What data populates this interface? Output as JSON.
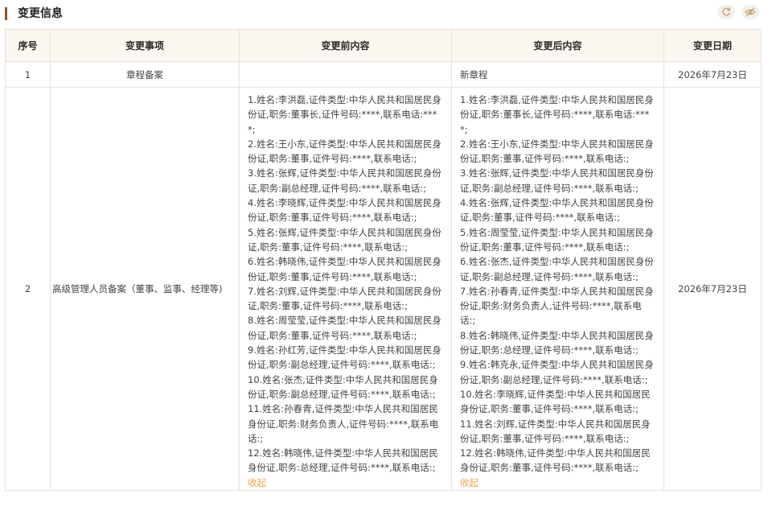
{
  "section": {
    "title": "变更信息"
  },
  "icons": {
    "refresh": "refresh-icon",
    "hide": "eye-off-icon"
  },
  "colors": {
    "accent_bar": "#8b572a",
    "header_bg": "#fcf6f1",
    "border": "#ebe2d8",
    "link": "#f2a652"
  },
  "table": {
    "headers": {
      "index": "序号",
      "item": "变更事项",
      "before": "变更前内容",
      "after": "变更后内容",
      "date": "变更日期"
    },
    "rows": [
      {
        "index": "1",
        "item": "章程备案",
        "before": "",
        "after": "新章程",
        "date": "2026年7月23日"
      },
      {
        "index": "2",
        "item": "高级管理人员备案（董事、监事、经理等)",
        "date": "2026年7月23日",
        "before_entries": [
          "1.姓名:李洪磊,证件类型:中华人民共和国居民身份证,职务:董事长,证件号码:****,联系电话:****;",
          "2.姓名:王小东,证件类型:中华人民共和国居民身份证,职务:董事,证件号码:****,联系电话:;",
          "3.姓名:张辉,证件类型:中华人民共和国居民身份证,职务:副总经理,证件号码:****,联系电话:;",
          "4.姓名:李晓辉,证件类型:中华人民共和国居民身份证,职务:董事,证件号码:****,联系电话:;",
          "5.姓名:张辉,证件类型:中华人民共和国居民身份证,职务:董事,证件号码:****,联系电话:;",
          "6.姓名:韩晓伟,证件类型:中华人民共和国居民身份证,职务:董事,证件号码:****,联系电话:;",
          "7.姓名:刘辉,证件类型:中华人民共和国居民身份证,职务:董事,证件号码:****,联系电话:;",
          "8.姓名:周莹莹,证件类型:中华人民共和国居民身份证,职务:董事,证件号码:****,联系电话:;",
          "9.姓名:孙红芳,证件类型:中华人民共和国居民身份证,职务:副总经理,证件号码:****,联系电话:;",
          "10.姓名:张杰,证件类型:中华人民共和国居民身份证,职务:副总经理,证件号码:****,联系电话:;",
          "11.姓名:孙春青,证件类型:中华人民共和国居民身份证,职务:财务负责人,证件号码:****,联系电话:;",
          "12.姓名:韩晓伟,证件类型:中华人民共和国居民身份证,职务:总经理,证件号码:****,联系电话:;"
        ],
        "after_entries": [
          "1.姓名:李洪磊,证件类型:中华人民共和国居民身份证,职务:董事长,证件号码:****,联系电话:****;",
          "2.姓名:王小东,证件类型:中华人民共和国居民身份证,职务:董事,证件号码:****,联系电话:;",
          "3.姓名:张辉,证件类型:中华人民共和国居民身份证,职务:副总经理,证件号码:****,联系电话:;",
          "4.姓名:张辉,证件类型:中华人民共和国居民身份证,职务:董事,证件号码:****,联系电话:;",
          "5.姓名:周莹莹,证件类型:中华人民共和国居民身份证,职务:董事,证件号码:****,联系电话:;",
          "6.姓名:张杰,证件类型:中华人民共和国居民身份证,职务:副总经理,证件号码:****,联系电话:;",
          "7.姓名:孙春青,证件类型:中华人民共和国居民身份证,职务:财务负责人,证件号码:****,联系电话:;",
          "8.姓名:韩晓伟,证件类型:中华人民共和国居民身份证,职务:总经理,证件号码:****,联系电话:;",
          "9.姓名:韩克永,证件类型:中华人民共和国居民身份证,职务:副总经理,证件号码:****,联系电话:;",
          "10.姓名:李晓辉,证件类型:中华人民共和国居民身份证,职务:董事,证件号码:****,联系电话:;",
          "11.姓名:刘辉,证件类型:中华人民共和国居民身份证,职务:董事,证件号码:****,联系电话:;",
          "12.姓名:韩晓伟,证件类型:中华人民共和国居民身份证,职务:董事,证件号码:****,联系电话:;"
        ],
        "collapse_label": "收起"
      }
    ]
  }
}
